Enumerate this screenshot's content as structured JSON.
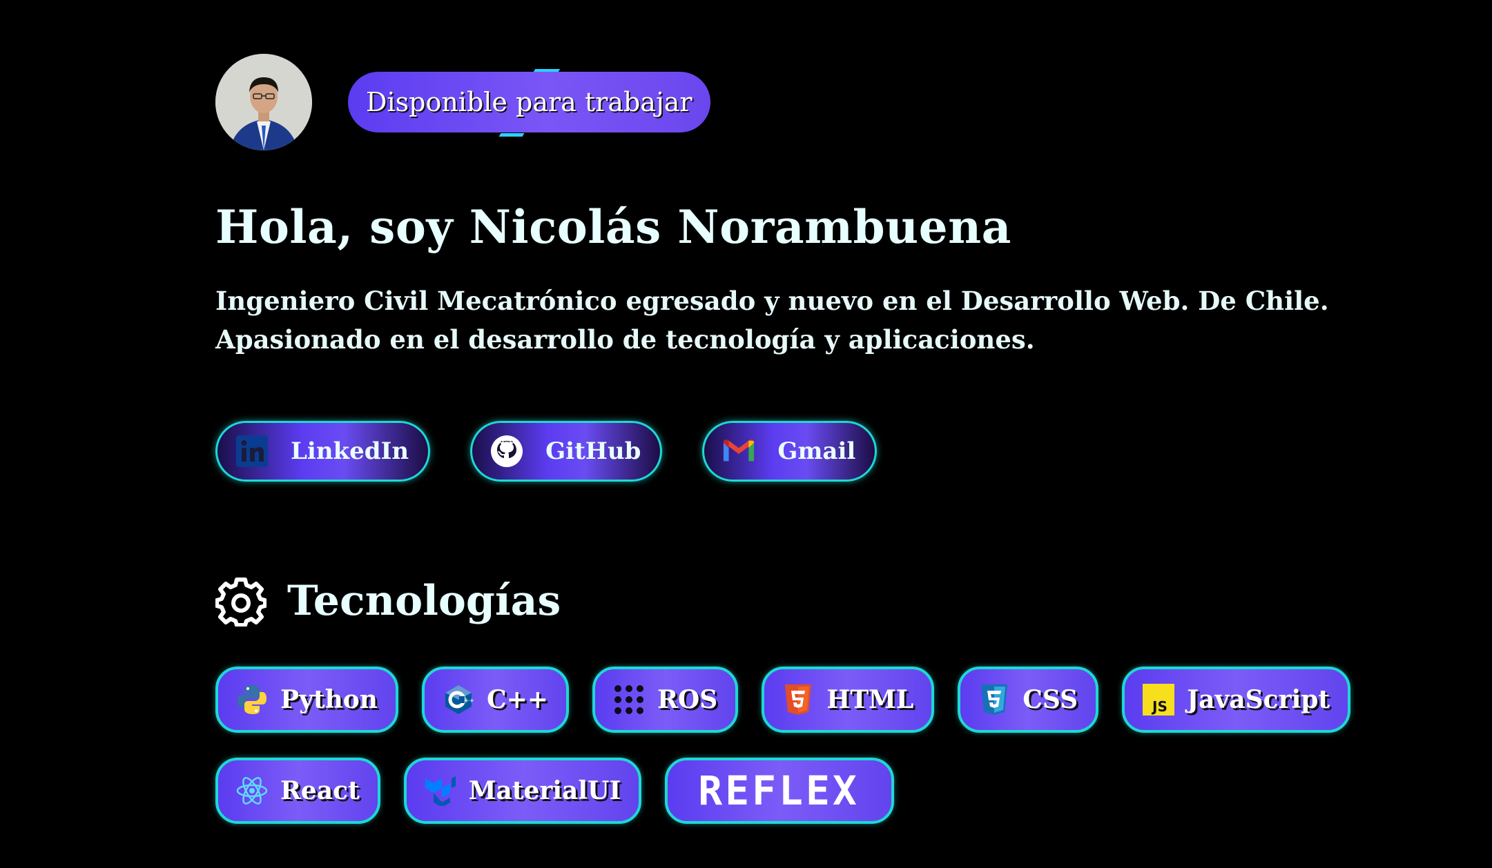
{
  "profile": {
    "avatar_alt": "avatar",
    "availability_badge": "Disponible para trabajar",
    "title": "Hola, soy Nicolás Norambuena",
    "description_line_1": "Ingeniero Civil Mecatrónico egresado y nuevo en el Desarrollo Web. De Chile.",
    "description_line_2": "Apasionado en el desarrollo de tecnología y aplicaciones."
  },
  "social": [
    {
      "label": "LinkedIn",
      "icon": "linkedin-icon"
    },
    {
      "label": "GitHub",
      "icon": "github-icon"
    },
    {
      "label": "Gmail",
      "icon": "gmail-icon"
    }
  ],
  "technologies": {
    "heading": "Tecnologías",
    "heading_icon": "gear-icon",
    "items": [
      {
        "label": "Python",
        "icon": "python-icon"
      },
      {
        "label": "C++",
        "icon": "cpp-icon"
      },
      {
        "label": "ROS",
        "icon": "ros-icon"
      },
      {
        "label": "HTML",
        "icon": "html5-icon"
      },
      {
        "label": "CSS",
        "icon": "css3-icon"
      },
      {
        "label": "JavaScript",
        "icon": "javascript-icon"
      },
      {
        "label": "React",
        "icon": "react-icon"
      },
      {
        "label": "MaterialUI",
        "icon": "materialui-icon"
      },
      {
        "label": "REFLEX",
        "icon": "reflex-logo"
      }
    ]
  },
  "colors": {
    "background": "#000000",
    "accent_purple": "#5b3cf0",
    "accent_cyan": "#1ed8d4",
    "text": "#e8ffff"
  }
}
